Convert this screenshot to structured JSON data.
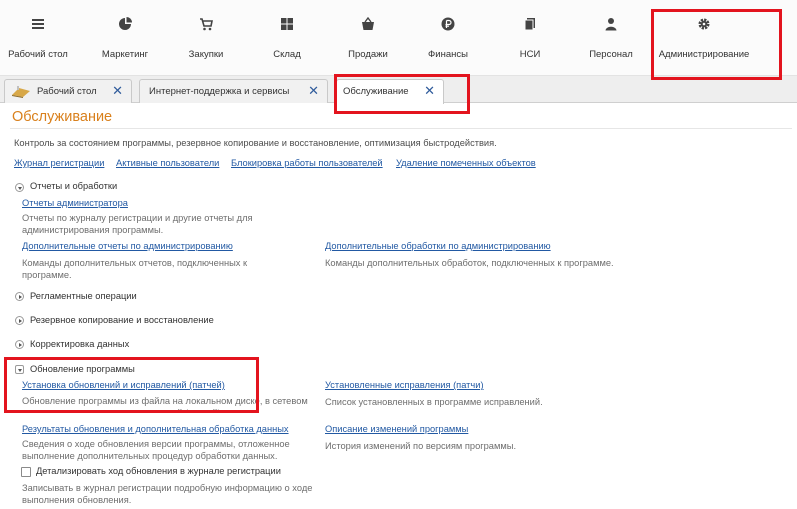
{
  "sections": [
    {
      "label": "Рабочий стол",
      "icon": "desktop-icon"
    },
    {
      "label": "Маркетинг",
      "icon": "chart-icon"
    },
    {
      "label": "Закупки",
      "icon": "cart-icon"
    },
    {
      "label": "Склад",
      "icon": "warehouse-icon"
    },
    {
      "label": "Продажи",
      "icon": "basket-icon"
    },
    {
      "label": "Финансы",
      "icon": "ruble-icon"
    },
    {
      "label": "НСИ",
      "icon": "docs-icon"
    },
    {
      "label": "Персонал",
      "icon": "person-icon"
    },
    {
      "label": "Администрирование",
      "icon": "gear-icon"
    }
  ],
  "tabs": [
    {
      "label": "Рабочий стол"
    },
    {
      "label": "Интернет-поддержка и сервисы"
    },
    {
      "label": "Обслуживание"
    }
  ],
  "page": {
    "title": "Обслуживание",
    "description": "Контроль за состоянием программы, резервное копирование и восстановление, оптимизация быстродействия.",
    "links": [
      "Журнал регистрации",
      "Активные пользователи",
      "Блокировка работы пользователей",
      "Удаление помеченных объектов"
    ]
  },
  "groups": {
    "reports": {
      "title": "Отчеты и обработки",
      "admin_reports_link": "Отчеты администратора",
      "admin_reports_desc": "Отчеты по журналу регистрации и другие отчеты для администрирования программы.",
      "extra_reports_link": "Дополнительные отчеты по администрированию",
      "extra_reports_desc": "Команды дополнительных отчетов, подключенных к программе.",
      "extra_processing_link": "Дополнительные обработки по администрированию",
      "extra_processing_desc": "Команды дополнительных обработок, подключенных к программе."
    },
    "scheduled": {
      "title": "Регламентные операции"
    },
    "backup": {
      "title": "Резервное копирование и восстановление"
    },
    "correction": {
      "title": "Корректировка данных"
    },
    "update": {
      "title": "Обновление программы",
      "install_link": "Установка обновлений и исправлений (патчей)",
      "install_desc": "Обновление программы из файла на локальном диске, в сетевом каталоге или установка исправлений (патчей).",
      "installed_link": "Установленные исправления (патчи)",
      "installed_desc": "Список установленных в программе исправлений.",
      "results_link": "Результаты обновления и дополнительная обработка данных",
      "results_desc": "Сведения о ходе обновления версии программы, отложенное выполнение дополнительных процедур обработки данных.",
      "changes_link": "Описание изменений программы",
      "changes_desc": "История изменений по версиям программы.",
      "detail_checkbox": "Детализировать ход обновления в журнале регистрации",
      "detail_desc": "Записывать в журнал регистрации подробную информацию о ходе выполнения обновления."
    }
  },
  "colors": {
    "highlight": "#e3141e",
    "title": "#d9801c",
    "link": "#2259a3"
  }
}
